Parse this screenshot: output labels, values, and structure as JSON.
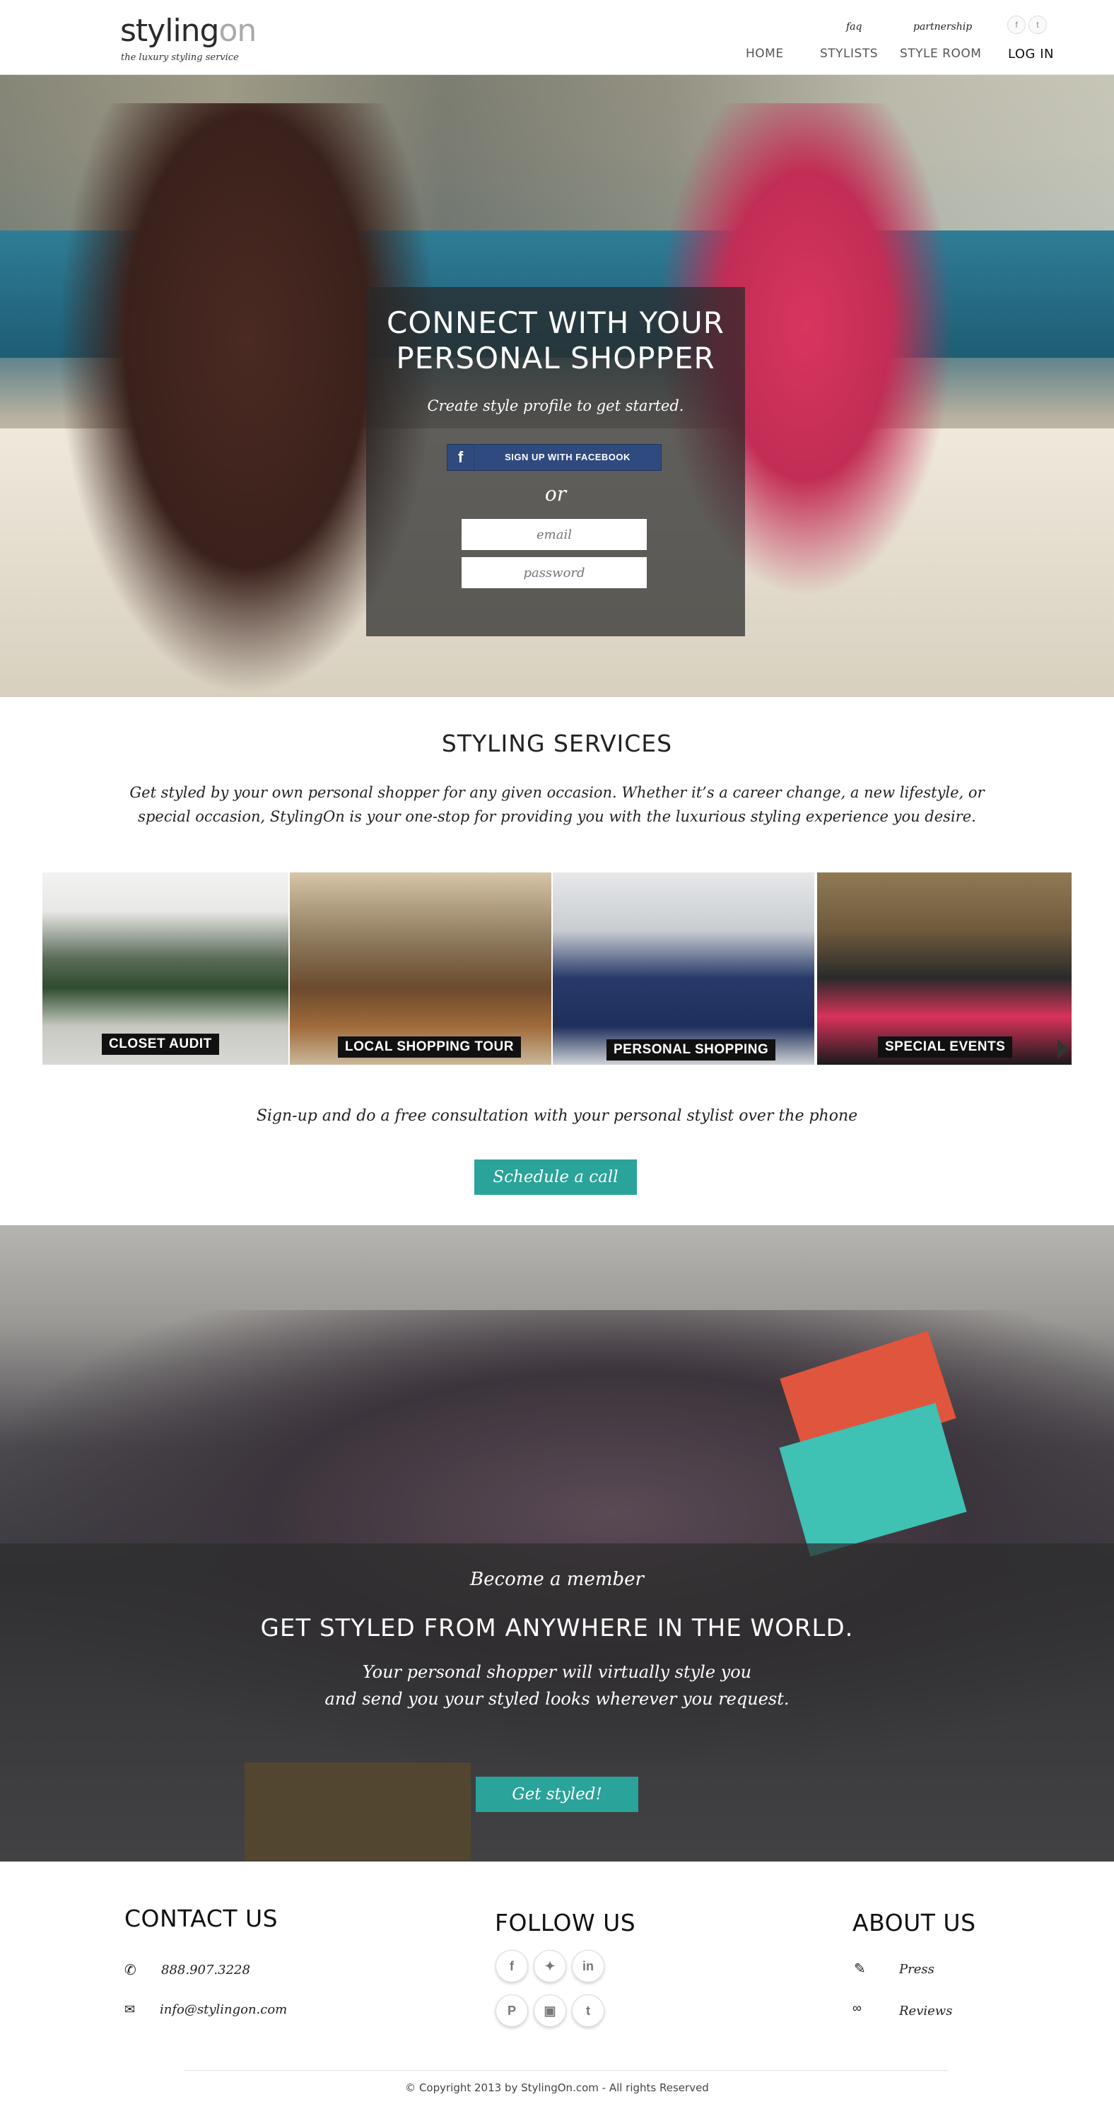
{
  "brand": {
    "logo_part1": "styling",
    "logo_part2": "on",
    "tagline": "the luxury styling service"
  },
  "header": {
    "faq": "faq",
    "partnership": "partnership",
    "nav": {
      "home": "HOME",
      "stylists": "STYLISTS",
      "style_room": "STYLE ROOM",
      "login": "LOG IN"
    },
    "social": {
      "facebook": "f",
      "twitter": "t"
    }
  },
  "hero": {
    "title_line1": "CONNECT WITH YOUR",
    "title_line2": "PERSONAL SHOPPER",
    "subtitle": "Create style profile to get started.",
    "facebook_button": "SIGN UP WITH FACEBOOK",
    "or": "or",
    "email_placeholder": "email",
    "password_placeholder": "password"
  },
  "services": {
    "title": "STYLING SERVICES",
    "description_line1": "Get styled by your own personal shopper for any given occasion. Whether it’s a career change, a new lifestyle, or",
    "description_line2": "special occasion, StylingOn is your one-stop for providing you with the luxurious styling experience you desire.",
    "tiles": [
      {
        "label": "CLOSET AUDIT"
      },
      {
        "label": "LOCAL SHOPPING TOUR"
      },
      {
        "label": "PERSONAL SHOPPING"
      },
      {
        "label": "SPECIAL EVENTS"
      }
    ],
    "consult_text": "Sign-up and do a free consultation with your personal stylist over the phone",
    "schedule_button": "Schedule a call"
  },
  "member": {
    "become": "Become a member",
    "headline": "GET STYLED FROM ANYWHERE IN THE WORLD.",
    "line1": "Your personal shopper will virtually style you",
    "line2": "and send you your styled looks wherever you request.",
    "button": "Get styled!"
  },
  "footer": {
    "contact_title": "CONTACT US",
    "phone": "888.907.3228",
    "email": "info@stylingon.com",
    "follow_title": "FOLLOW US",
    "about_title": "ABOUT US",
    "press": "Press",
    "reviews": "Reviews",
    "copyright": "© Copyright 2013 by StylingOn.com - All rights Reserved"
  },
  "colors": {
    "accent_teal": "#2aa39a",
    "facebook_blue": "#2f4a7e"
  },
  "icons": [
    "facebook-icon",
    "twitter-icon",
    "linkedin-icon",
    "pinterest-icon",
    "instagram-icon",
    "tumblr-icon",
    "phone-icon",
    "envelope-icon",
    "press-icon",
    "glasses-icon",
    "next-arrow-icon"
  ]
}
